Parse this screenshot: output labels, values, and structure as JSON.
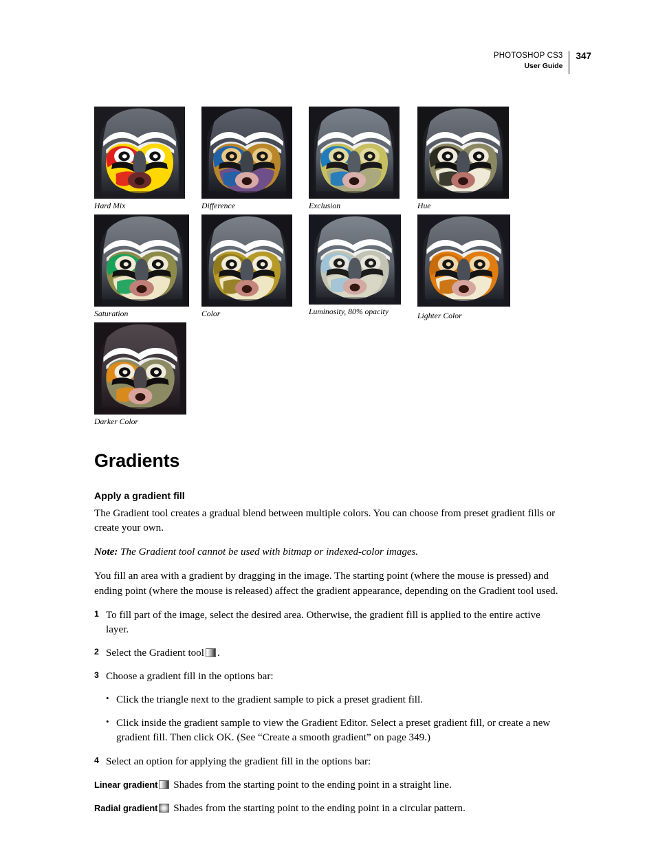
{
  "header": {
    "product": "PHOTOSHOP CS3",
    "doc": "User Guide",
    "page_number": "347"
  },
  "figures": {
    "rows": [
      [
        {
          "caption": "Hard Mix",
          "variant": "hard-mix"
        },
        {
          "caption": "Difference",
          "variant": "difference"
        },
        {
          "caption": "Exclusion",
          "variant": "exclusion"
        },
        {
          "caption": "Hue",
          "variant": "hue"
        }
      ],
      [
        {
          "caption": "Saturation",
          "variant": "saturation"
        },
        {
          "caption": "Color",
          "variant": "color"
        },
        {
          "caption": "Luminosity, 80% opacity",
          "variant": "luminosity"
        },
        {
          "caption": "Lighter Color",
          "variant": "lighter-color"
        }
      ],
      [
        {
          "caption": "Darker Color",
          "variant": "darker-color"
        }
      ]
    ]
  },
  "section": {
    "title": "Gradients",
    "subtitle": "Apply a gradient fill",
    "intro": "The Gradient tool creates a gradual blend between multiple colors. You can choose from preset gradient fills or create your own.",
    "note_label": "Note:",
    "note_text": "The Gradient tool cannot be used with bitmap or indexed-color images.",
    "paragraph2": "You fill an area with a gradient by dragging in the image. The starting point (where the mouse is pressed) and ending point (where the mouse is released) affect the gradient appearance, depending on the Gradient tool used.",
    "steps": [
      {
        "num": "1",
        "text": "To fill part of the image, select the desired area. Otherwise, the gradient fill is applied to the entire active layer."
      },
      {
        "num": "2",
        "text_before": "Select the Gradient tool",
        "icon": "gradient-tool-icon",
        "text_after": "."
      },
      {
        "num": "3",
        "text": "Choose a gradient fill in the options bar:"
      },
      {
        "num": "4",
        "text": "Select an option for applying the gradient fill in the options bar:"
      }
    ],
    "bullets": [
      "Click the triangle next to the gradient sample to pick a preset gradient fill.",
      "Click inside the gradient sample to view the Gradient Editor. Select a preset gradient fill, or create a new gradient fill. Then click OK. (See “Create a smooth gradient” on page 349.)"
    ],
    "definitions": [
      {
        "term": "Linear gradient",
        "icon": "linear-gradient-icon",
        "text": "Shades from the starting point to the ending point in a straight line."
      },
      {
        "term": "Radial gradient",
        "icon": "radial-gradient-icon",
        "text": "Shades from the starting point to the ending point in a circular pattern."
      }
    ]
  },
  "image_palettes": {
    "hard-mix": {
      "bg": "#1b1b20",
      "wood_top": "#4a4e56",
      "wood_mid": "#6a6e76",
      "face": "#ffd800",
      "accent": "#e02020",
      "eye_ring": "#ffffff",
      "brow": "#111111",
      "beak": "#4c5058",
      "lips": "#6b2a2a",
      "mouth": "#2a1210",
      "lower": "#ffd800",
      "stripe": "#ffffff"
    },
    "difference": {
      "bg": "#141419",
      "wood_top": "#3d424c",
      "wood_mid": "#5b606a",
      "face": "#b9862a",
      "accent": "#1f62a8",
      "eye_ring": "#e8c884",
      "brow": "#161616",
      "beak": "#3e434b",
      "lips": "#d7aaa6",
      "mouth": "#2a1210",
      "lower": "#6f4f8a",
      "stripe": "#ffffff"
    },
    "exclusion": {
      "bg": "#16161b",
      "wood_top": "#5a606a",
      "wood_mid": "#7a818a",
      "face": "#c8c060",
      "accent": "#1f7bbd",
      "eye_ring": "#e2d9a0",
      "brow": "#1a1a1a",
      "beak": "#555b63",
      "lips": "#d9b0ac",
      "mouth": "#2a1210",
      "lower": "#a9a87e",
      "stripe": "#ffffff"
    },
    "hue": {
      "bg": "#141418",
      "wood_top": "#4f545c",
      "wood_mid": "#72777f",
      "face": "#8b8763",
      "accent": "#2a2a20",
      "eye_ring": "#efeadb",
      "brow": "#121212",
      "beak": "#4a4f57",
      "lips": "#b8736c",
      "mouth": "#30140f",
      "lower": "#efe9d7",
      "stripe": "#ffffff"
    },
    "saturation": {
      "bg": "#15151a",
      "wood_top": "#565b64",
      "wood_mid": "#787d86",
      "face": "#8d8a4a",
      "accent": "#18a15a",
      "eye_ring": "#f0ead6",
      "brow": "#131313",
      "beak": "#4d525a",
      "lips": "#c08078",
      "mouth": "#33140f",
      "lower": "#efe6c8",
      "stripe": "#ffffff"
    },
    "color": {
      "bg": "#14141a",
      "wood_top": "#585d66",
      "wood_mid": "#7b8189",
      "face": "#b59a27",
      "accent": "#8f7a1c",
      "eye_ring": "#f2ecd6",
      "brow": "#141414",
      "beak": "#4e535b",
      "lips": "#c3857c",
      "mouth": "#341510",
      "lower": "#efe7c4",
      "stripe": "#ffffff"
    },
    "luminosity": {
      "bg": "#181820",
      "wood_top": "#5c626b",
      "wood_mid": "#7f858e",
      "face": "#c3c3b4",
      "accent": "#9fc3d6",
      "eye_ring": "#e6e6dc",
      "brow": "#1c1c1c",
      "beak": "#52575f",
      "lips": "#d2a9a3",
      "mouth": "#351813",
      "lower": "#d8d6c4",
      "stripe": "#ffffff"
    },
    "lighter-color": {
      "bg": "#17171d",
      "wood_top": "#4e535b",
      "wood_mid": "#71767e",
      "face": "#e07c10",
      "accent": "#c96b08",
      "eye_ring": "#f0d6a8",
      "brow": "#161616",
      "beak": "#4a4f57",
      "lips": "#d6a69e",
      "mouth": "#35160f",
      "lower": "#f2ead0",
      "stripe": "#ffffff"
    },
    "darker-color": {
      "bg": "#1a1418",
      "wood_top": "#3a3338",
      "wood_mid": "#4f474c",
      "face": "#8b8a62",
      "accent": "#e08a18",
      "eye_ring": "#f0ecdc",
      "brow": "#100d0f",
      "beak": "#4a464a",
      "lips": "#d7a49c",
      "mouth": "#2e130f",
      "lower": "#8b8a62",
      "stripe": "#ffffff"
    }
  }
}
